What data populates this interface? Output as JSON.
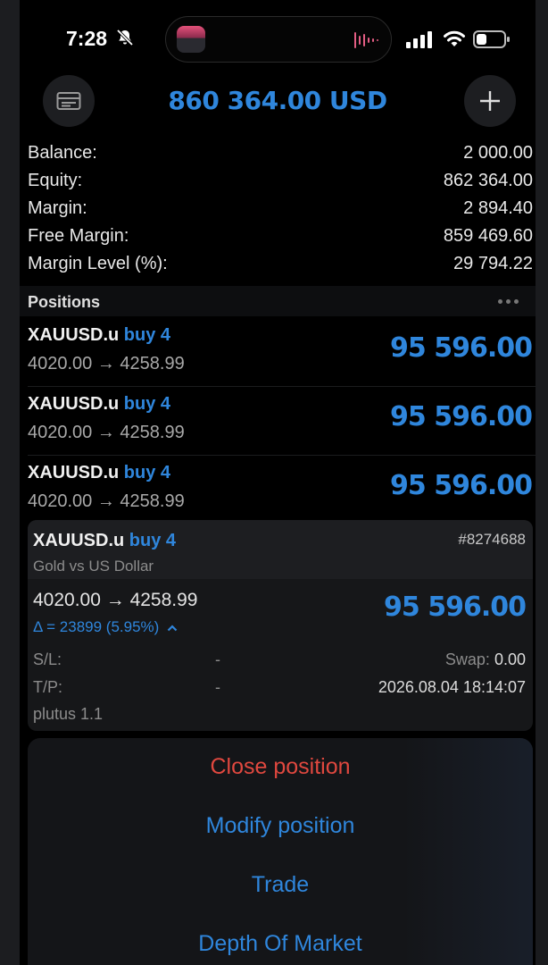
{
  "status_bar": {
    "time": "7:28"
  },
  "header": {
    "equity_display": "860 364.00 USD"
  },
  "summary": [
    {
      "label": "Balance:",
      "value": "2 000.00"
    },
    {
      "label": "Equity:",
      "value": "862 364.00"
    },
    {
      "label": "Margin:",
      "value": "2 894.40"
    },
    {
      "label": "Free Margin:",
      "value": "859 469.60"
    },
    {
      "label": "Margin Level (%):",
      "value": "29 794.22"
    }
  ],
  "positions_title": "Positions",
  "positions": [
    {
      "symbol": "XAUUSD.u",
      "side": "buy 4",
      "prices": "4020.00 → 4258.99",
      "profit": "95 596.00"
    },
    {
      "symbol": "XAUUSD.u",
      "side": "buy 4",
      "prices": "4020.00 → 4258.99",
      "profit": "95 596.00"
    },
    {
      "symbol": "XAUUSD.u",
      "side": "buy 4",
      "prices": "4020.00 → 4258.99",
      "profit": "95 596.00"
    }
  ],
  "expanded": {
    "symbol": "XAUUSD.u",
    "side": "buy 4",
    "ticket": "#8274688",
    "description": "Gold vs US Dollar",
    "prices": "4020.00 → 4258.99",
    "delta": "Δ = 23899 (5.95%)",
    "profit": "95 596.00",
    "sl_label": "S/L:",
    "sl_value": "-",
    "tp_label": "T/P:",
    "tp_value": "-",
    "swap_label": "Swap:",
    "swap_value": "0.00",
    "open_time": "2026.08.04 18:14:07",
    "comment": "plutus 1.1"
  },
  "actions": {
    "close": "Close position",
    "modify": "Modify position",
    "trade": "Trade",
    "depth": "Depth Of Market"
  },
  "colors": {
    "accent": "#2f86dc",
    "destructive": "#e0483f",
    "background": "#000000"
  }
}
